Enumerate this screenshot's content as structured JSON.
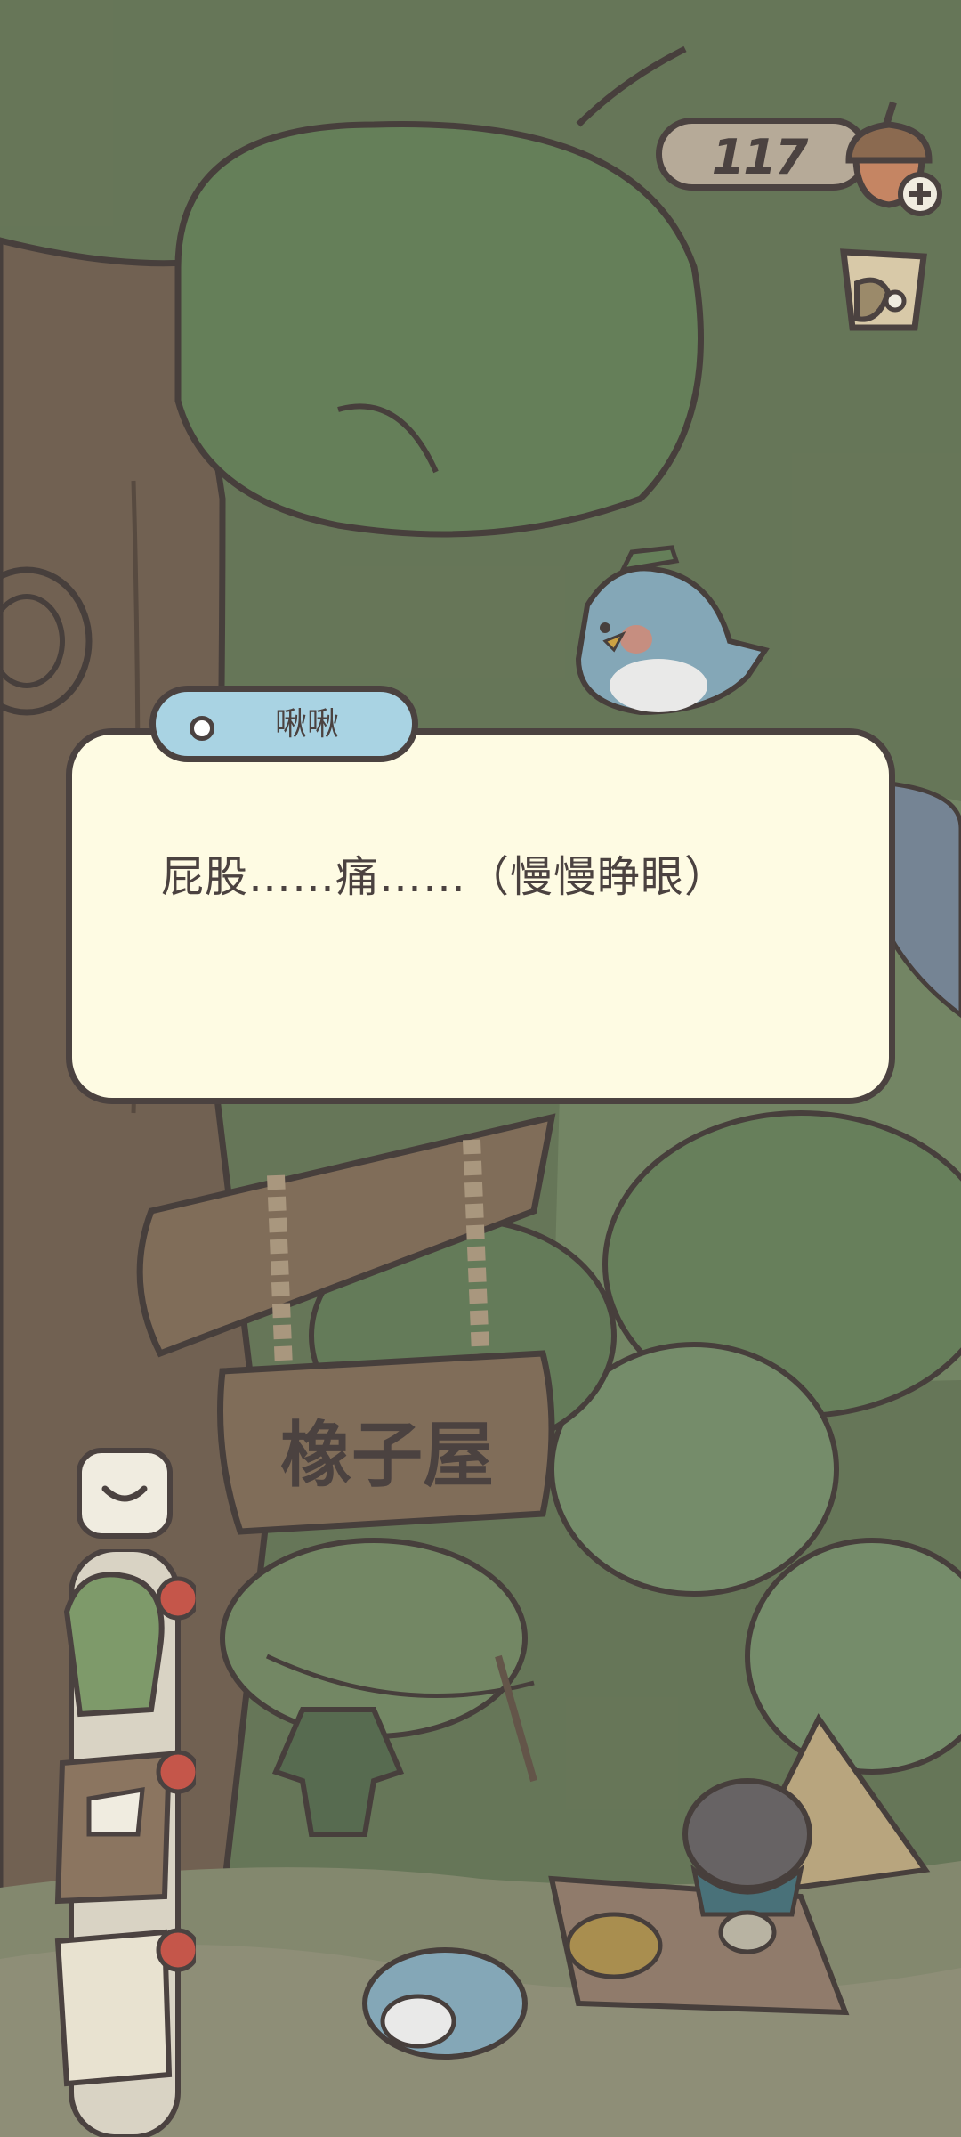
{
  "hud": {
    "acorn_count": "117",
    "acorn_icon": "acorn-plus-icon",
    "cup_icon": "cup-icon"
  },
  "dialog": {
    "speaker": "啾啾",
    "text": "屁股……痛……（慢慢睁眼）"
  },
  "sign": {
    "text": "橡子屋"
  },
  "side_menu": {
    "collapse_icon": "chevron-down-icon",
    "items": [
      "backpack-icon",
      "journal-icon",
      "album-icon"
    ]
  },
  "colors": {
    "background": "#6e7f5f",
    "outline": "#4b4240",
    "dialog_bg": "#fefbe3",
    "speaker_tag_bg": "#a9d3e3",
    "counter_bg": "#b6aa98"
  }
}
